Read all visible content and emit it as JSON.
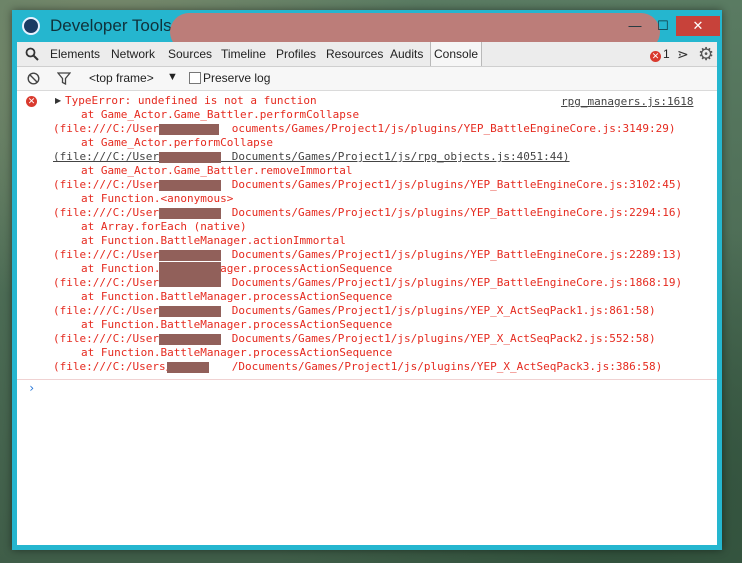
{
  "window": {
    "title": "Developer Tools",
    "minimize_glyph": "—",
    "maximize_glyph": "☐",
    "close_glyph": "✕"
  },
  "tabs": [
    {
      "label": "Elements"
    },
    {
      "label": "Network"
    },
    {
      "label": "Sources"
    },
    {
      "label": "Timeline"
    },
    {
      "label": "Profiles"
    },
    {
      "label": "Resources"
    },
    {
      "label": "Audits"
    },
    {
      "label": "Console"
    }
  ],
  "error_count": "1",
  "toolbar": {
    "frame_selector": "<top frame>",
    "preserve_log_label": "Preserve log"
  },
  "console": {
    "error": {
      "message": "TypeError: undefined is not a function",
      "source": "rpg_managers.js:1618",
      "lines": [
        "at Game_Actor.Game_Battler.performCollapse",
        "(file:///C:/Users/         ocuments/Games/Project1/js/plugins/YEP_BattleEngineCore.js:3149:29)",
        "at Game_Actor.performCollapse",
        "(file:///C:/Users/         Documents/Games/Project1/js/rpg_objects.js:4051:44)",
        "at Game_Actor.Game_Battler.removeImmortal",
        "(file:///C:/Users/         Documents/Games/Project1/js/plugins/YEP_BattleEngineCore.js:3102:45)",
        "at Function.<anonymous>",
        "(file:///C:/Users/         Documents/Games/Project1/js/plugins/YEP_BattleEngineCore.js:2294:16)",
        "at Array.forEach (native)",
        "at Function.BattleManager.actionImmortal",
        "(file:///C:/Users/         Documents/Games/Project1/js/plugins/YEP_BattleEngineCore.js:2289:13)",
        "at Function.BattleManager.processActionSequence",
        "(file:///C:/Users/         Documents/Games/Project1/js/plugins/YEP_BattleEngineCore.js:1868:19)",
        "at Function.BattleManager.processActionSequence",
        "(file:///C:/Users/         Documents/Games/Project1/js/plugins/YEP_X_ActSeqPack1.js:861:58)",
        "at Function.BattleManager.processActionSequence",
        "(file:///C:/Users/         Documents/Games/Project1/js/plugins/YEP_X_ActSeqPack2.js:552:58)",
        "at Function.BattleManager.processActionSequence",
        "(file:///C:/Users/         /Documents/Games/Project1/js/plugins/YEP_X_ActSeqPack3.js:386:58)"
      ]
    },
    "prompt_glyph": "›"
  },
  "colors": {
    "window_frame": "#25b6cf",
    "error_text": "#e52a1f",
    "close_button": "#c7423a",
    "prompt": "#2a78d8"
  }
}
